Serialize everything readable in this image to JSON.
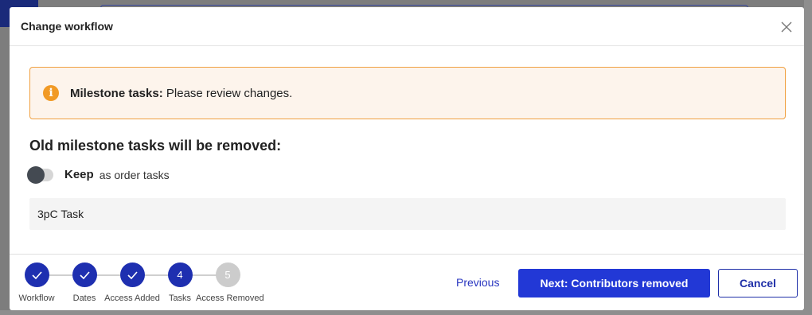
{
  "modal": {
    "title": "Change workflow",
    "close_icon": "close-icon"
  },
  "alert": {
    "icon": "info-icon",
    "icon_glyph": "i",
    "strong": "Milestone tasks:",
    "message": "Please review changes."
  },
  "section": {
    "title": "Old milestone tasks will be removed:"
  },
  "keep_toggle": {
    "label_strong": "Keep",
    "label": "as order tasks",
    "checked": false
  },
  "tasks": [
    {
      "name": "3pC Task"
    }
  ],
  "stepper": {
    "steps": [
      {
        "label": "Workflow",
        "status": "done",
        "text": ""
      },
      {
        "label": "Dates",
        "status": "done",
        "text": ""
      },
      {
        "label": "Access Added",
        "status": "done",
        "text": ""
      },
      {
        "label": "Tasks",
        "status": "current",
        "text": "4"
      },
      {
        "label": "Access Removed",
        "status": "todo",
        "text": "5"
      }
    ]
  },
  "footer": {
    "previous_label": "Previous",
    "next_label": "Next: Contributors removed",
    "cancel_label": "Cancel"
  },
  "colors": {
    "primary": "#2238d6",
    "step_active": "#1e2fb0",
    "step_inactive": "#cccccc",
    "alert_border": "#f0a040",
    "alert_bg": "#fdf4ec",
    "alert_icon": "#f19a26"
  }
}
